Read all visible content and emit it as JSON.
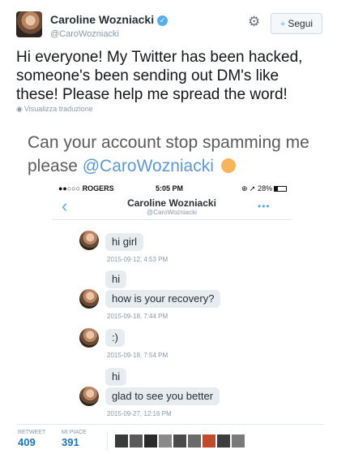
{
  "author": {
    "display_name": "Caroline Wozniacki",
    "handle": "@CaroWozniacki",
    "verified_icon": "✓"
  },
  "header": {
    "settings_icon": "gear-icon",
    "follow_label": "Segui",
    "follow_icon": "+"
  },
  "tweet": {
    "text": "Hi everyone! My Twitter has been hacked, someone's been sending out DM's like these! Please help me spread the word!",
    "translate_label": "Visualizza traduzione"
  },
  "media": {
    "quote_text": "Can your account stop spamming me please",
    "quote_mention": "@CaroWozniacki",
    "phone": {
      "carrier": "●●○○○ ROGERS",
      "time": "5:05 PM",
      "battery": "⊕ ➚ 28%",
      "chat_name": "Caroline Wozniacki",
      "chat_handle": "@CaroWozniacki",
      "back_icon": "‹",
      "more_icon": "•••"
    },
    "messages": [
      {
        "text": "hi girl",
        "timestamp": "2015-09-12, 4:53 PM"
      },
      {
        "text": "hi",
        "timestamp": ""
      },
      {
        "text": "how is your recovery?",
        "timestamp": "2015-09-18, 7:44 PM"
      },
      {
        "text": ":)",
        "timestamp": "2015-09-18, 7:54 PM"
      },
      {
        "text": "hi",
        "timestamp": ""
      },
      {
        "text": "glad to see you better",
        "timestamp": "2015-09-27, 12:16 PM"
      }
    ]
  },
  "stats": {
    "retweets_label": "RETWEET",
    "retweets_value": "409",
    "likes_label": "MI PIACE",
    "likes_value": "391",
    "liker_colors": [
      "#3a3a3a",
      "#5a5a5a",
      "#2a2a2a",
      "#8a8a8a",
      "#4a4a4a",
      "#6a6a6a",
      "#c24a2a",
      "#3d3d3d",
      "#7a7a7a"
    ]
  }
}
